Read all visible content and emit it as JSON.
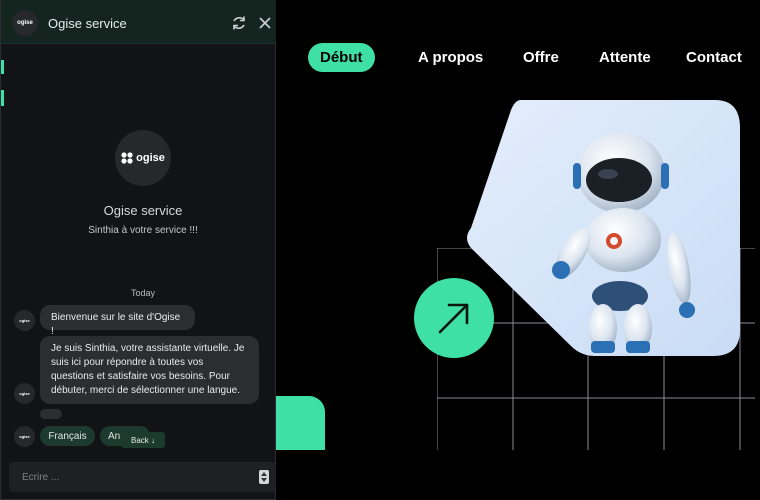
{
  "nav": {
    "items": [
      {
        "label": "Début",
        "active": true
      },
      {
        "label": "A propos"
      },
      {
        "label": "Offre"
      },
      {
        "label": "Attente"
      },
      {
        "label": "Contact"
      }
    ]
  },
  "hero": {
    "arrow_icon": "arrow-up-right-icon",
    "image": "robot-illustration",
    "accent_color": "#3ee0a6"
  },
  "chat": {
    "header_title": "Ogise service",
    "logo_text": "ogise",
    "service_name": "Ogise service",
    "service_subtitle": "Sinthia à votre service !!!",
    "date_divider": "Today",
    "messages": [
      {
        "text": "Bienvenue sur le site d'Ogise !"
      },
      {
        "text": "Je suis Sinthia, votre assistante virtuelle. Je suis ici pour répondre à toutes vos questions et satisfaire vos besoins. Pour débuter, merci de sélectionner une langue."
      }
    ],
    "language_options": [
      "Français",
      "An"
    ],
    "back_label": "Back ↓",
    "input_placeholder": "Ecrire ...",
    "icons": [
      "refresh-icon",
      "close-icon"
    ]
  }
}
